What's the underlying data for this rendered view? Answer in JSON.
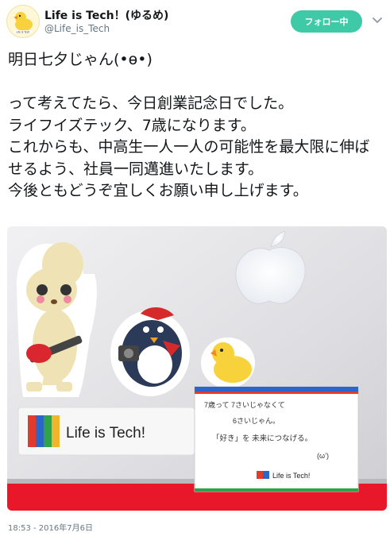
{
  "header": {
    "account_name": "Life is Tech！(ゆるめ)",
    "handle": "@Life_is_Tech",
    "follow_button_label": "フォロー中",
    "avatar_icon": "duck-logo-icon",
    "menu_icon": "chevron-down-icon"
  },
  "tweet": {
    "text": "明日七夕じゃん(•ө•)\n\nって考えてたら、今日創業記念日でした。\nライフイズテック、7歳になります。\nこれからも、中高生一人一人の可能性を最大限に伸ばせるよう、社員一同邁進いたします。\n今後ともどうぞ宜しくお願い申し上げます。",
    "timestamp": "18:53 - 2016年7月6日"
  },
  "photo": {
    "laptop_brand_icon": "apple-logo-icon",
    "sticker_logo": "LT",
    "sticker_brand": "Life is Tech!",
    "card": {
      "line1": "7歳って 7さいじゃなくて",
      "line2": "6さいじゃん。",
      "line3": "「好き」を 未来につなげる。",
      "line4": "(ω’)",
      "footer_logo": "Life is Tech!"
    }
  },
  "colors": {
    "follow_button": "#3ec9a7",
    "text": "#14171a",
    "secondary_text": "#657786",
    "table_red": "#e8182a",
    "laptop_silver": "#dcdcdf"
  }
}
